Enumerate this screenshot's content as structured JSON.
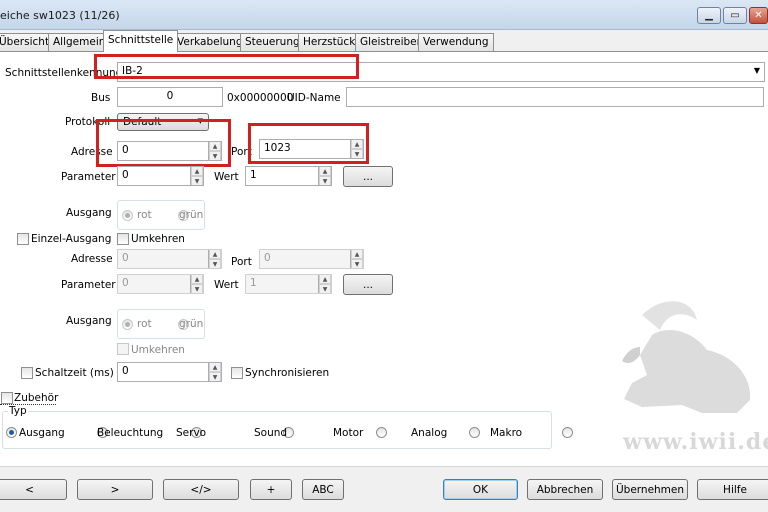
{
  "window": {
    "title": "eiche sw1023 (11/26)",
    "min_icon": "minimize-icon",
    "max_icon": "maximize-icon",
    "close_icon": "close-icon"
  },
  "tabs": [
    {
      "label": "Übersicht",
      "active": false
    },
    {
      "label": "Allgemein",
      "active": false
    },
    {
      "label": "Schnittstelle",
      "active": true
    },
    {
      "label": "Verkabelung",
      "active": false
    },
    {
      "label": "Steuerung",
      "active": false
    },
    {
      "label": "Herzstück",
      "active": false
    },
    {
      "label": "Gleistreiber",
      "active": false
    },
    {
      "label": "Verwendung",
      "active": false
    }
  ],
  "interface": {
    "id_label": "Schnittstellenkennung",
    "id_value": "IB-2",
    "bus_label": "Bus",
    "bus_value": "0",
    "bus_hex": "0x00000000",
    "uid_label": "UID-Name",
    "uid_value": "",
    "protocol_label": "Protokoll",
    "protocol_value": "Default",
    "address_label": "Adresse",
    "address_value": "0",
    "port_label": "Port",
    "port_value": "1023",
    "param_label": "Parameter",
    "param_value": "0",
    "value_label": "Wert",
    "value_value": "1",
    "ellipsis_label": "..."
  },
  "output1": {
    "label": "Ausgang",
    "red_label": "rot",
    "green_label": "grün",
    "selected": "rot"
  },
  "single_output": {
    "label": "Einzel-Ausgang",
    "checked": false,
    "invert_label": "Umkehren",
    "invert_checked": false,
    "address_label": "Adresse",
    "address_value": "0",
    "port_label": "Port",
    "port_value": "0",
    "param_label": "Parameter",
    "param_value": "0",
    "value_label": "Wert",
    "value_value": "1",
    "ellipsis_label": "..."
  },
  "output2": {
    "label": "Ausgang",
    "red_label": "rot",
    "green_label": "grün",
    "selected": "rot",
    "invert_label": "Umkehren"
  },
  "switch_time": {
    "label": "Schaltzeit (ms)",
    "value": "0",
    "sync_label": "Synchronisieren"
  },
  "accessory": {
    "label": "Zubehör",
    "type_label": "Typ",
    "options": [
      "Ausgang",
      "Beleuchtung",
      "Servo",
      "Sound",
      "Motor",
      "Analog",
      "Makro"
    ],
    "selected": "Ausgang"
  },
  "watermark": {
    "text": "www.iwii.de",
    "icon": "ibex-watermark-icon"
  },
  "footer": {
    "prev": "<",
    "next": ">",
    "code": "</>",
    "plus": "+",
    "abc": "ABC",
    "ok": "OK",
    "cancel": "Abbrechen",
    "apply": "Übernehmen",
    "help": "Hilfe"
  },
  "colors": {
    "highlight_box": "#d21f1f",
    "selection_blue": "#1e5aa8"
  }
}
